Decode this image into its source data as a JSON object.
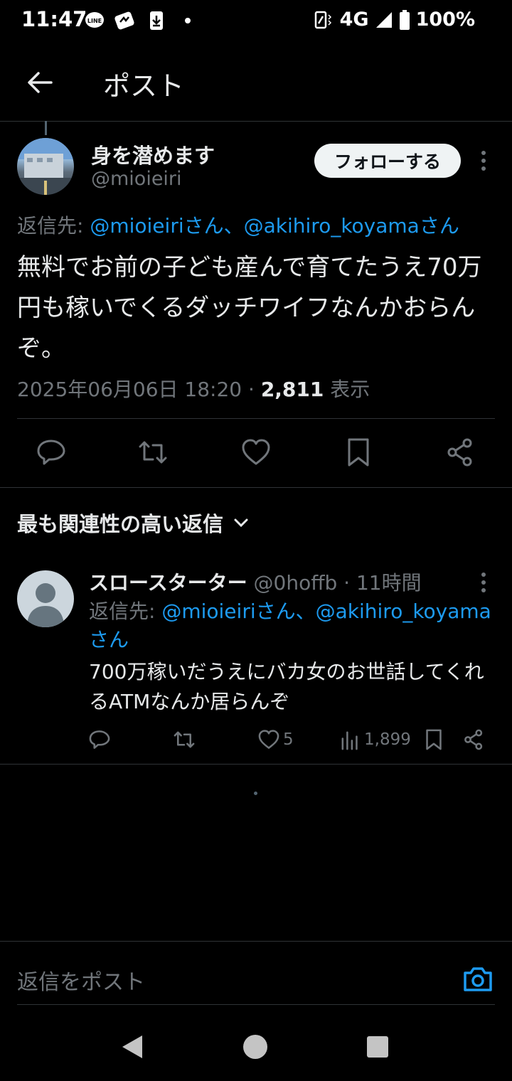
{
  "status": {
    "time": "11:47",
    "network": "4G",
    "battery": "100%"
  },
  "header": {
    "title": "ポスト"
  },
  "post": {
    "author_name": "身を潜めます",
    "author_handle": "@mioieiri",
    "follow_label": "フォローする",
    "reply_prefix": "返信先: ",
    "reply_mention1": "@mioieiriさん",
    "reply_sep": "、",
    "reply_mention2": "@akihiro_koyamaさん",
    "text": "無料でお前の子ども産んで育てたうえ70万円も稼いでくるダッチワイフなんかおらんぞ。",
    "timestamp": "2025年06月06日 18:20 · ",
    "views_count": "2,811",
    "views_label": " 表示"
  },
  "replies_section": {
    "title": "最も関連性の高い返信"
  },
  "reply": {
    "name": "スロースターター",
    "handle_time": " @0hoffb · 11時間",
    "reply_prefix": "返信先: ",
    "reply_mention1": "@mioieiriさん",
    "reply_sep": "、",
    "reply_mention2": "@akihiro_koyamaさん",
    "text": "700万稼いだうえにバカ女のお世話してくれるATMなんか居らんぞ",
    "likes": "5",
    "views": "1,899"
  },
  "compose": {
    "placeholder": "返信をポスト"
  },
  "colors": {
    "accent": "#1d9bf0",
    "muted": "#71767b",
    "text": "#e7e9ea",
    "divider": "#2f3336"
  }
}
